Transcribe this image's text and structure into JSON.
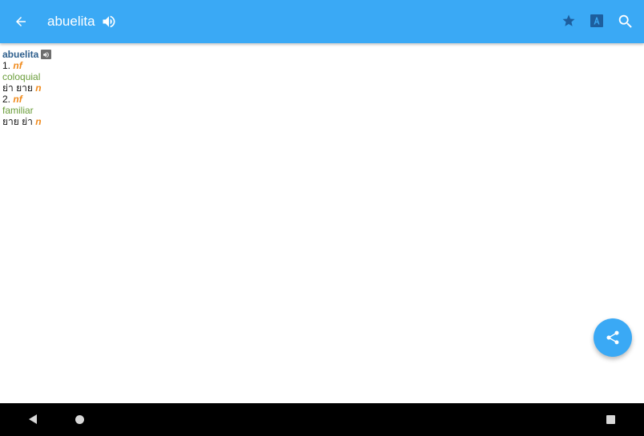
{
  "toolbar": {
    "title": "abuelita",
    "background_color": "#3aa9f5",
    "icons": [
      "back-arrow-icon",
      "speaker-icon",
      "star-icon",
      "translate-icon",
      "search-icon"
    ]
  },
  "entry": {
    "headword": "abuelita",
    "senses": [
      {
        "number": "1.",
        "pos": "nf",
        "register": "coloquial",
        "translation": "ย่า ยาย",
        "translation_pos": "n"
      },
      {
        "number": "2.",
        "pos": "nf",
        "register": "familiar",
        "translation": "ยาย ย่า",
        "translation_pos": "n"
      }
    ]
  },
  "fab": {
    "icon": "share-icon",
    "color": "#3aa9f5"
  },
  "navbar": {
    "icons": [
      "nav-back-icon",
      "nav-home-icon",
      "nav-recents-icon"
    ]
  }
}
